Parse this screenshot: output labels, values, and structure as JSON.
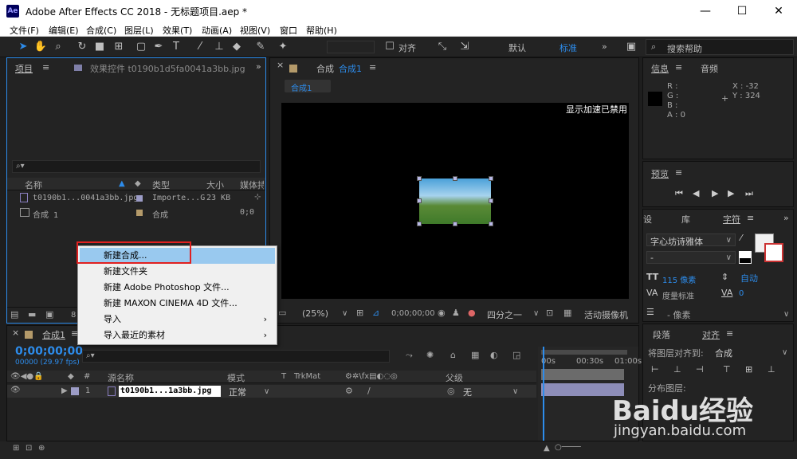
{
  "window": {
    "title": "Adobe After Effects CC 2018 - 无标题项目.aep *",
    "logo": "Ae",
    "min": "—",
    "max": "☐",
    "close": "✕"
  },
  "menu": [
    "文件(F)",
    "编辑(E)",
    "合成(C)",
    "图层(L)",
    "效果(T)",
    "动画(A)",
    "视图(V)",
    "窗口",
    "帮助(H)"
  ],
  "toolbar": {
    "align_label": "对齐",
    "workspace_default": "默认",
    "workspace_standard": "标准",
    "more": "»",
    "search_placeholder": "搜索帮助"
  },
  "project_panel": {
    "tab_project": "项目",
    "tab_effects": "效果控件 t0190b1d5fa0041a3bb.jpg",
    "more": "»",
    "search_icon": "⌕▾",
    "columns": [
      "名称",
      "类型",
      "大小",
      "媒体持"
    ],
    "rows": [
      {
        "name": "t0190b1...0041a3bb.jpg",
        "type": "Importe...G",
        "size": "23 KB",
        "dur": ""
      },
      {
        "name": "合成 1",
        "type": "合成",
        "size": "",
        "dur": "0;0"
      }
    ],
    "bpc": "8 bpc"
  },
  "context_menu": {
    "items": [
      "新建合成...",
      "新建文件夹",
      "新建 Adobe Photoshop 文件...",
      "新建 MAXON CINEMA 4D 文件...",
      "导入",
      "导入最近的素材"
    ],
    "arrow": "›"
  },
  "comp_panel": {
    "tab": "合成",
    "tab_comp": "合成1",
    "sub_tab": "合成1",
    "notice": "显示加速已禁用",
    "zoom": "(25%)",
    "timecode": "0;00;00;00",
    "resolution": "四分之一",
    "camera": "活动摄像机"
  },
  "info_panel": {
    "tab_info": "信息",
    "tab_audio": "音频",
    "r": "R :",
    "g": "G :",
    "b": "B :",
    "a": "A : 0",
    "x": "X : -32",
    "y": "Y : 324"
  },
  "preview_panel": {
    "tab": "预览"
  },
  "character_panel": {
    "tabs": [
      "设",
      "库",
      "字符"
    ],
    "font": "字心坊诗雅体",
    "style": "-",
    "size": "115 像素",
    "leading": "自动",
    "tracking_label": "度量标准",
    "tracking_value": "0",
    "indent": "- 像素"
  },
  "paragraph_panel": {
    "tabs": [
      "段落",
      "对齐"
    ],
    "align_to_label": "将图层对齐到:",
    "align_to_value": "合成",
    "distribute_label": "分布图层:"
  },
  "timeline": {
    "tab": "合成1",
    "timecode": "0;00;00;00",
    "fps": "00000 (29.97 fps)",
    "columns": [
      "源名称",
      "模式",
      "T",
      "TrkMat",
      "父级"
    ],
    "layer_num": "1",
    "layer_name": "t0190b1...1a3bb.jpg",
    "layer_mode": "正常",
    "layer_parent": "无",
    "ruler": [
      "00s",
      "00:30s",
      "01:00s"
    ],
    "hash": "#"
  },
  "watermark": {
    "brand": "Baidu经验",
    "url": "jingyan.baidu.com"
  }
}
